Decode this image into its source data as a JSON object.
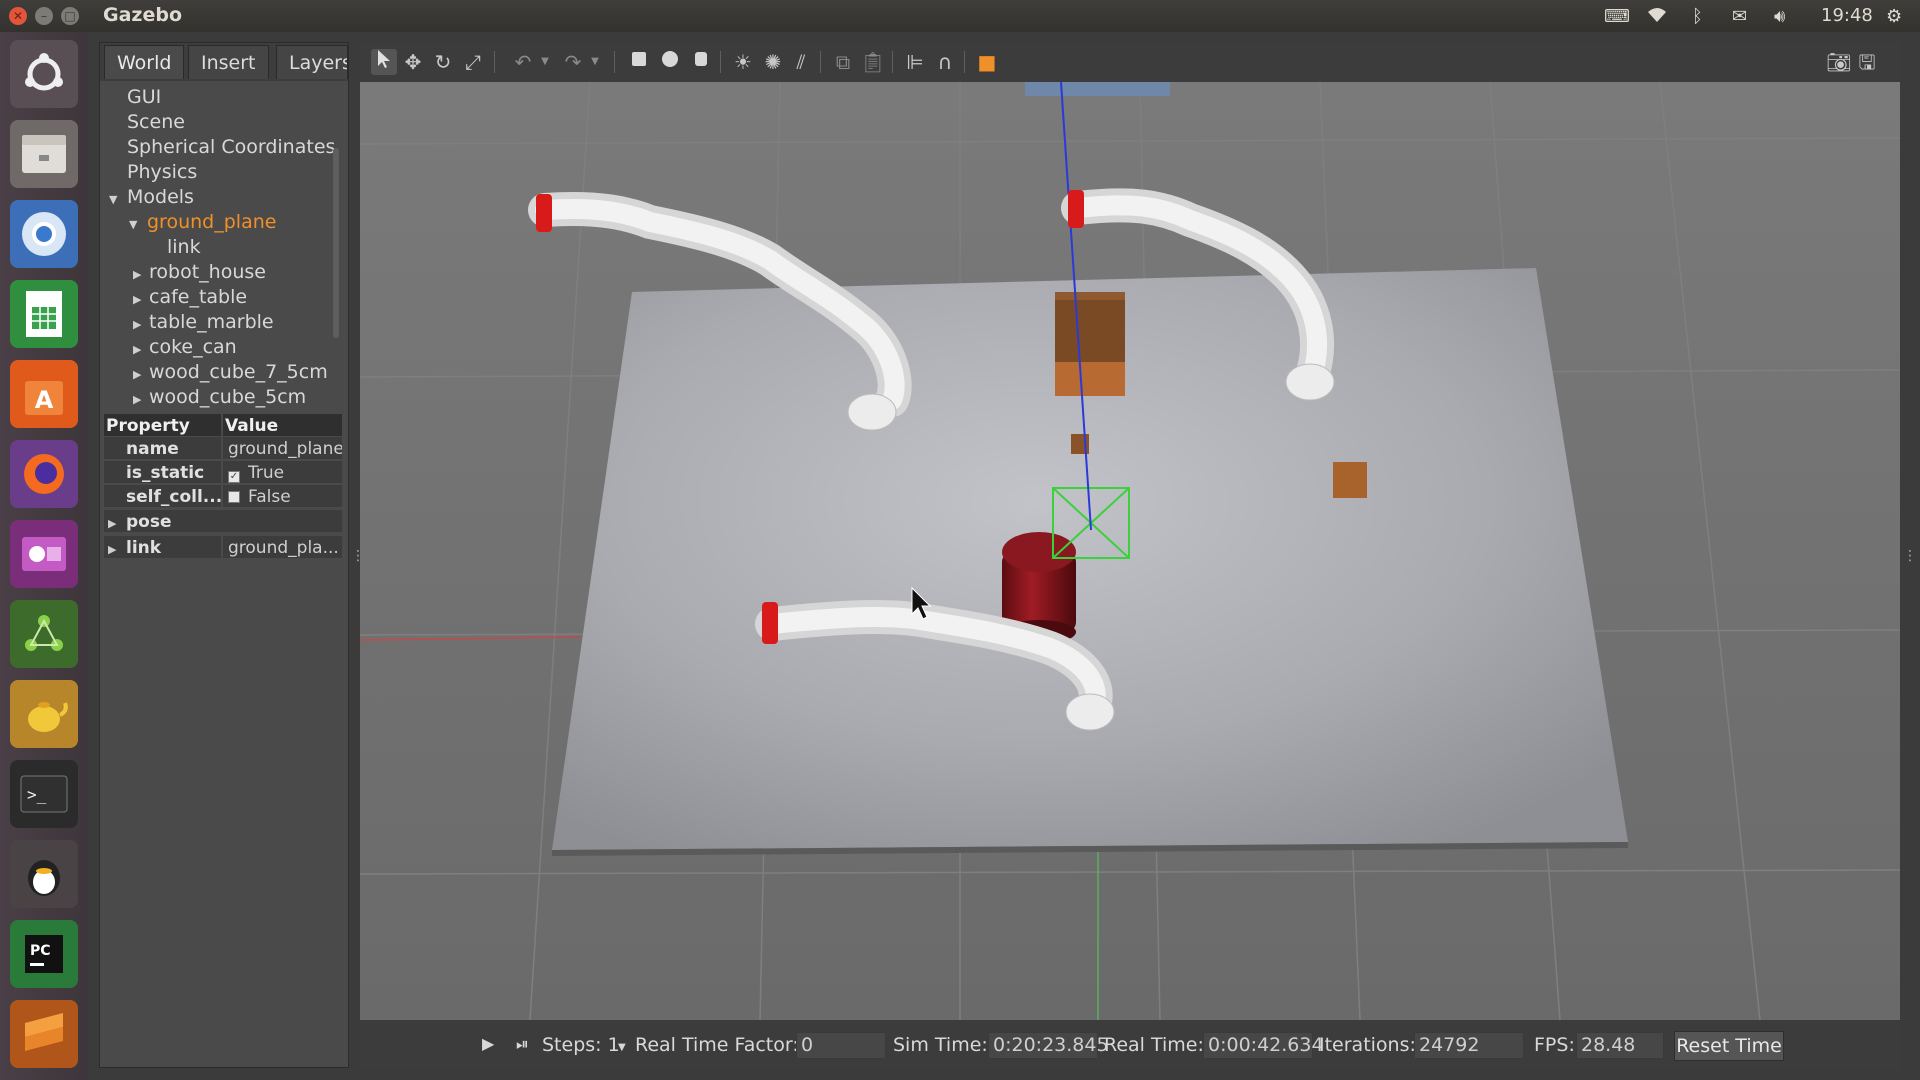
{
  "window": {
    "title": "Gazebo"
  },
  "tray": {
    "time": "19:48"
  },
  "left_panel": {
    "tabs": [
      {
        "label": "World"
      },
      {
        "label": "Insert"
      },
      {
        "label": "Layers"
      }
    ],
    "tree": {
      "gui": "GUI",
      "scene": "Scene",
      "spherical": "Spherical Coordinates",
      "physics": "Physics",
      "models": "Models",
      "ground_plane": "ground_plane",
      "link": "link",
      "robot_house": "robot_house",
      "cafe_table": "cafe_table",
      "table_marble": "table_marble",
      "coke_can": "coke_can",
      "wood_cube_7_5cm": "wood_cube_7_5cm",
      "wood_cube_5cm": "wood_cube_5cm"
    },
    "properties": {
      "header_property": "Property",
      "header_value": "Value",
      "name_key": "name",
      "name_value": "ground_plane",
      "is_static_key": "is_static",
      "is_static_value": "True",
      "self_coll_key": "self_coll...",
      "self_coll_value": "False",
      "pose_key": "pose",
      "link_key": "link",
      "link_value": "ground_pla..."
    }
  },
  "status": {
    "steps_label": "Steps: 1",
    "rtf_label": "Real Time Factor:",
    "rtf_value": "0",
    "sim_time_label": "Sim Time:",
    "sim_time_value": "0:20:23.845",
    "real_time_label": "Real Time:",
    "real_time_value": "0:00:42.634",
    "iterations_label": "Iterations:",
    "iterations_value": "24792",
    "fps_label": "FPS:",
    "fps_value": "28.48",
    "reset_label": "Reset Time"
  },
  "colors": {
    "selected_item": "#f0902a",
    "robot_tip": "#d81a1a",
    "selection_box": "#3ad13a",
    "axis_z": "#2a3ad8"
  }
}
